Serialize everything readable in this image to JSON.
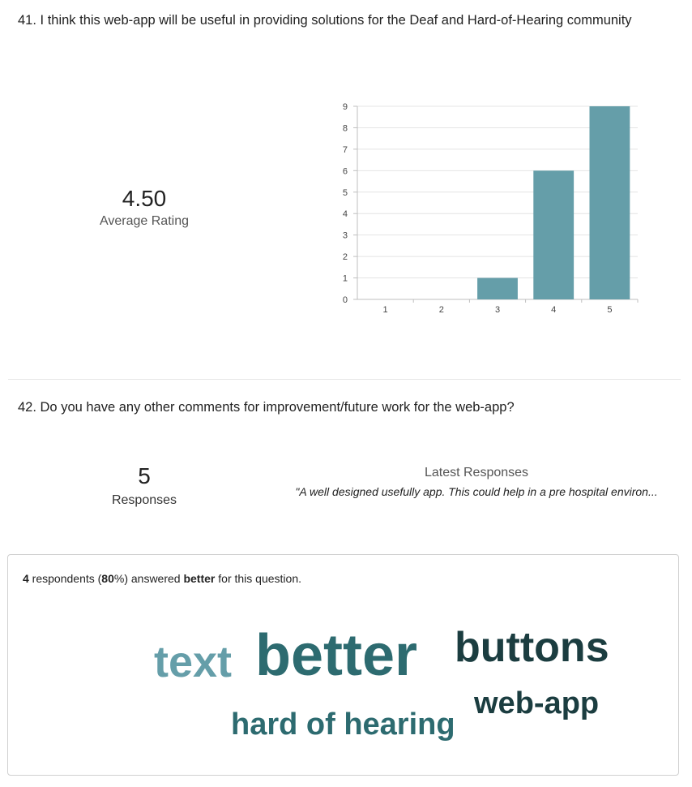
{
  "q41": {
    "title": "41.  I think this web-app will be useful in providing solutions for the Deaf and Hard-of-Hearing community",
    "average_value": "4.50",
    "average_label": "Average Rating"
  },
  "chart_data": {
    "type": "bar",
    "categories": [
      "1",
      "2",
      "3",
      "4",
      "5"
    ],
    "values": [
      0,
      0,
      1,
      6,
      9
    ],
    "ylim": [
      0,
      9
    ],
    "yticks": [
      0,
      1,
      2,
      3,
      4,
      5,
      6,
      7,
      8,
      9
    ],
    "grid": true,
    "bar_color": "#659ea9",
    "title": "",
    "xlabel": "",
    "ylabel": ""
  },
  "q42": {
    "title": "42.  Do you have any other comments for improvement/future work for the web-app?",
    "responses_count": "5",
    "responses_label": "Responses",
    "latest_title": "Latest Responses",
    "latest_text": "\"A well designed usefully app. This could help in a pre hospital environ...",
    "summary": {
      "count": "4",
      "text_a": " respondents (",
      "percent": "80",
      "text_b": "%) answered ",
      "keyword": "better",
      "text_c": " for this question."
    },
    "word_cloud": [
      {
        "word": "text",
        "color": "#659ea9"
      },
      {
        "word": "better",
        "color": "#2d6b70"
      },
      {
        "word": "buttons",
        "color": "#1b3d40"
      },
      {
        "word": "web-app",
        "color": "#1b3d40"
      },
      {
        "word": "hard of hearing",
        "color": "#2d6b70"
      }
    ]
  }
}
